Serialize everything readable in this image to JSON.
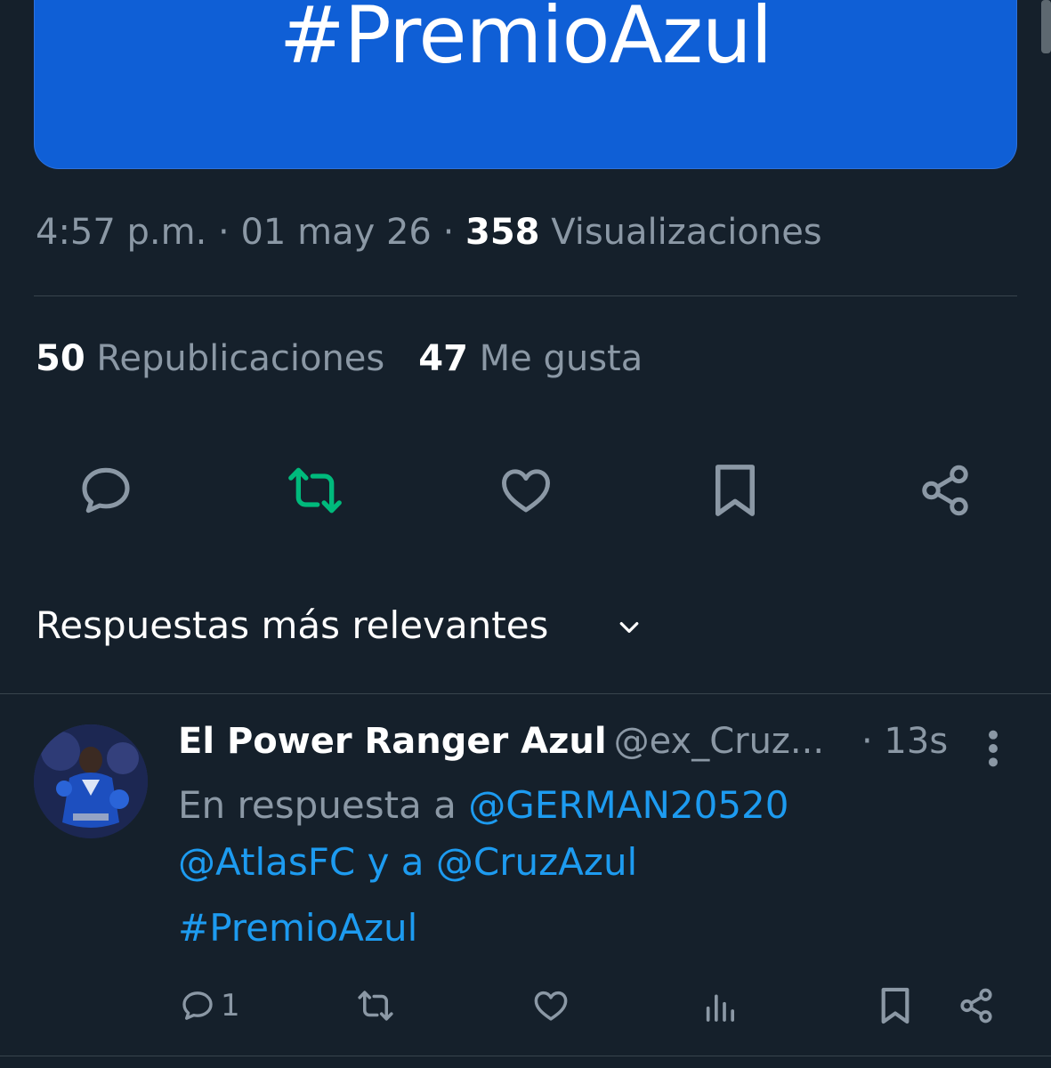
{
  "colors": {
    "background": "#15202b",
    "banner": "#0f5fd6",
    "muted": "#8b98a5",
    "link": "#1d9bf0",
    "repost_active": "#00ba7c",
    "divider": "#38444d"
  },
  "tweet": {
    "banner_text": "#PremioAzul",
    "time": "4:57 p.m.",
    "date": "01 may 26",
    "views_count": "358",
    "views_label": "Visualizaciones",
    "reposts_count": "50",
    "reposts_label": "Republicaciones",
    "likes_count": "47",
    "likes_label": "Me gusta",
    "actions": {
      "reply_icon": "comment-icon",
      "repost_icon": "repost-icon",
      "like_icon": "heart-icon",
      "bookmark_icon": "bookmark-icon",
      "share_icon": "share-icon",
      "repost_active": true
    }
  },
  "replies_section": {
    "title": "Respuestas más relevantes"
  },
  "reply": {
    "name": "El Power Ranger Azul",
    "handle": "@ex_Cruz...",
    "time": "· 13s",
    "in_reply_prefix": "En respuesta a",
    "mention_1": "@GERMAN20520",
    "mention_2": "@AtlasFC",
    "joiner": "y a",
    "mention_3": "@CruzAzul",
    "hashtag": "#PremioAzul",
    "reply_count": "1"
  }
}
